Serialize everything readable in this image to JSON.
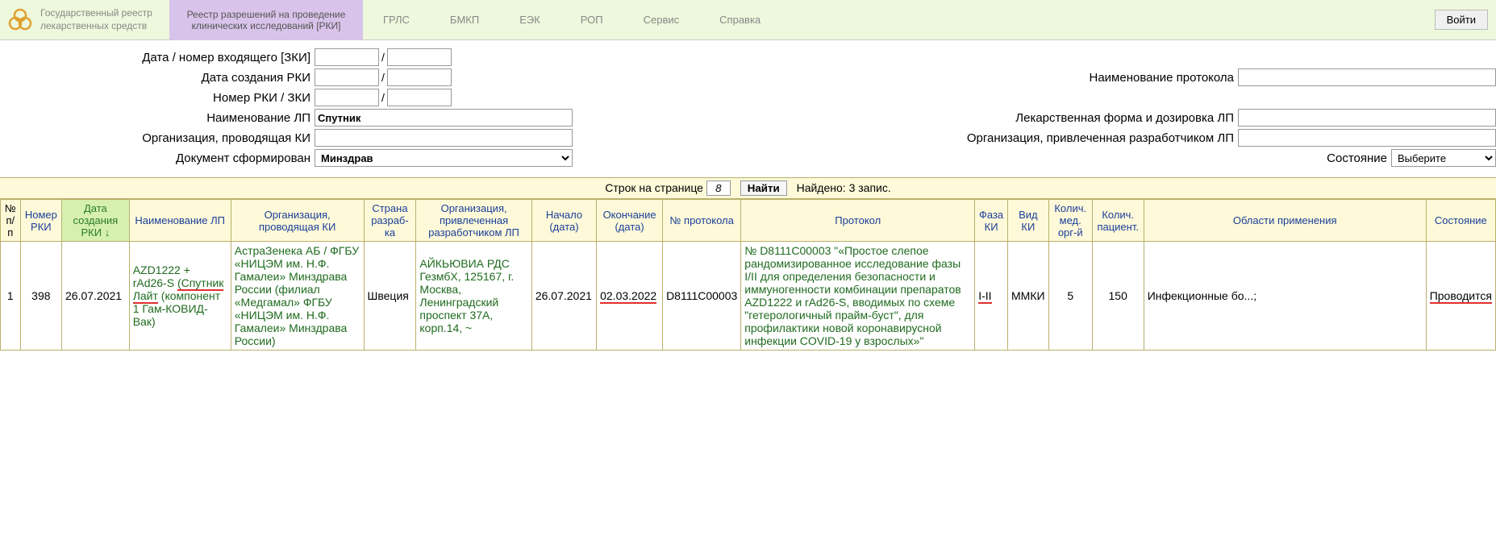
{
  "header": {
    "site_title": "Государственный реестр лекарственных средств",
    "active_tab": "Реестр разрешений на проведение клинических исследований [РКИ]",
    "nav": [
      "ГРЛС",
      "БМКП",
      "ЕЭК",
      "РОП",
      "Сервис",
      "Справка"
    ],
    "login": "Войти"
  },
  "filters": {
    "labels": {
      "incoming": "Дата / номер входящего [ЗКИ]",
      "created": "Дата создания РКИ",
      "num": "Номер РКИ / ЗКИ",
      "lp": "Наименование ЛП",
      "org": "Организация, проводящая КИ",
      "doc": "Документ сформирован",
      "proto": "Наименование протокола",
      "form": "Лекарственная форма и дозировка ЛП",
      "devorg": "Организация, привлеченная разработчиком ЛП",
      "state": "Состояние"
    },
    "lp_value": "Спутник",
    "doc_value": "Минздрав",
    "state_value": "Выберите"
  },
  "toolbar": {
    "rows_label": "Строк на странице",
    "rows_value": "8",
    "find": "Найти",
    "found": "Найдено: 3 запис."
  },
  "columns": [
    "№ п/п",
    "Номер РКИ",
    "Дата создания РКИ",
    "Наименование ЛП",
    "Организация, проводящая КИ",
    "Страна разраб-ка",
    "Организация, привлеченная разработчиком ЛП",
    "Начало (дата)",
    "Окончание (дата)",
    "№ протокола",
    "Протокол",
    "Фаза КИ",
    "Вид КИ",
    "Колич. мед. орг-й",
    "Колич. пациент.",
    "Области применения",
    "Состояние"
  ],
  "row": {
    "idx": "1",
    "num": "398",
    "created": "26.07.2021",
    "lp_a": "AZD1222 + rAd26-S ",
    "lp_b": "(Спутник Лайт",
    "lp_c": " (компонент 1 Гам-КОВИД-Вак)",
    "org": "АстраЗенека АБ / ФГБУ «НИЦЭМ им. Н.Ф. Гамалеи» Минздрава России (филиал «Медгамал» ФГБУ «НИЦЭМ им. Н.Ф. Гамалеи» Минздрава России)",
    "country": "Швеция",
    "devorg": "АЙКЬЮВИА РДС ГезмбХ, 125167, г. Москва, Ленинградский проспект 37А, корп.14, ~",
    "start": "26.07.2021",
    "end": "02.03.2022",
    "proto_num": "D8111C00003",
    "protocol": "№ D8111C00003 \"«Простое слепое рандомизированное исследование фазы I/II для определения безопасности и иммуногенности комбинации препаратов AZD1222 и rAd26-S, вводимых по схеме \"гетерологичный прайм-буст\", для профилактики новой коронавирусной инфекции COVID-19 у взрослых»\"",
    "phase": "I-II",
    "type": "ММКИ",
    "orgs_count": "5",
    "patients": "150",
    "area": "Инфекционные бо...;",
    "state": "Проводится"
  }
}
